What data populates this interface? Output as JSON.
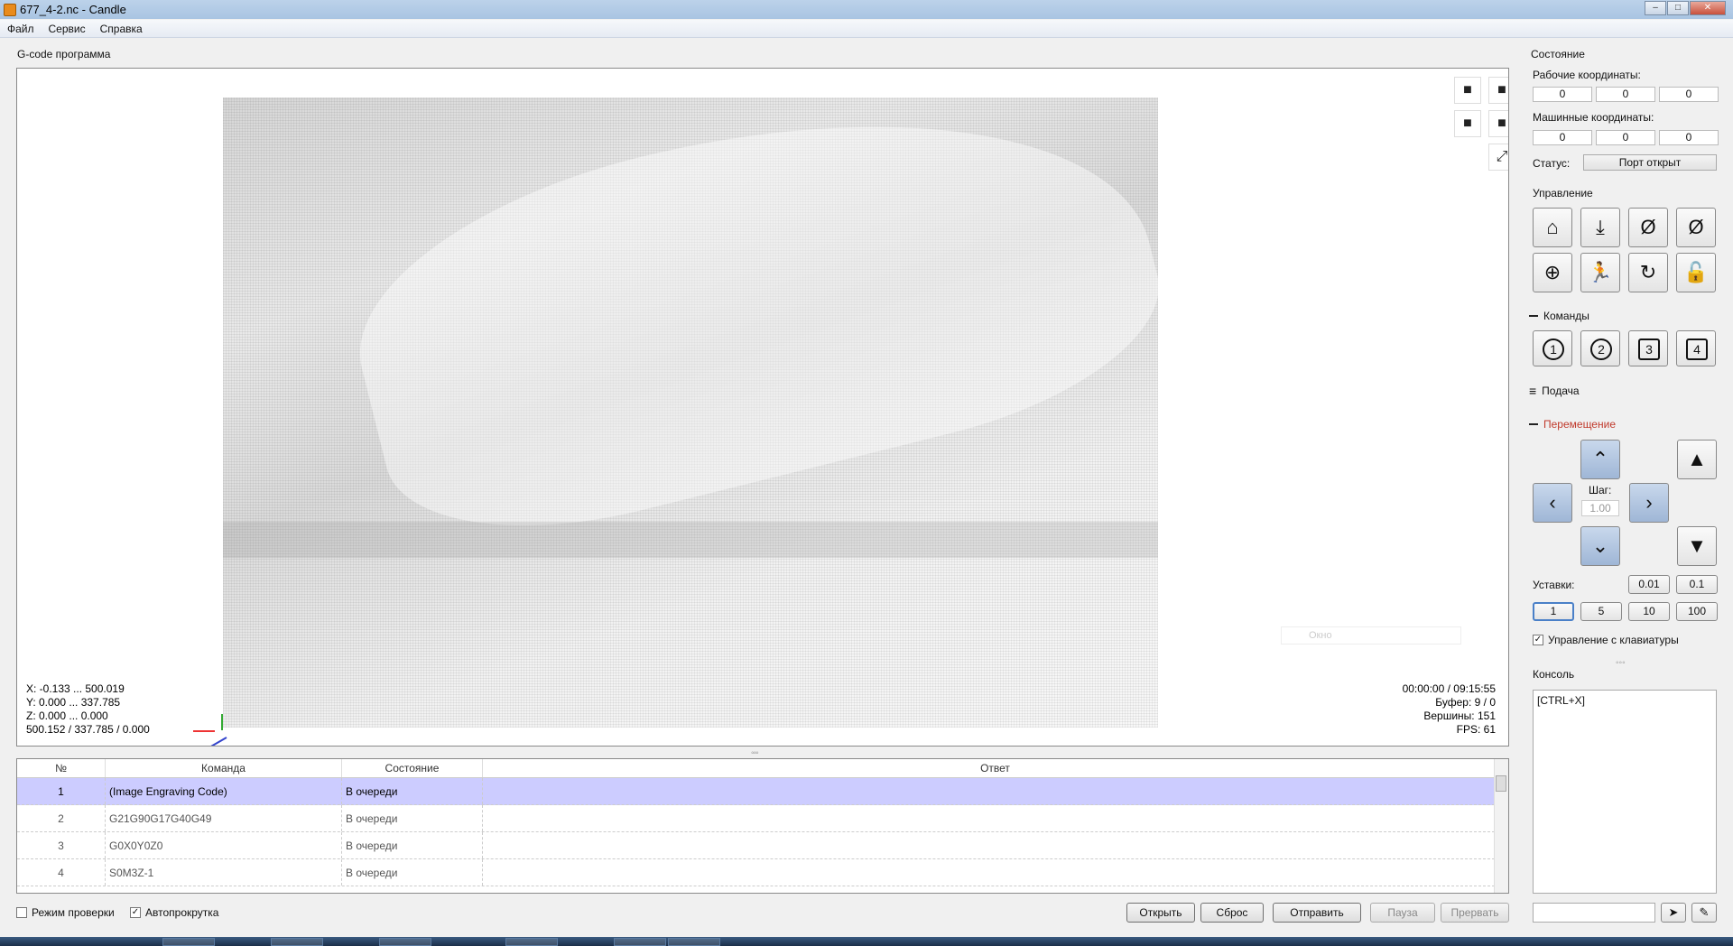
{
  "window": {
    "title": "677_4-2.nc - Candle",
    "min": "–",
    "max": "□",
    "close": "✕"
  },
  "menu": [
    "Файл",
    "Сервис",
    "Справка"
  ],
  "gcode_title": "G-code программа",
  "viewport": {
    "stats_left": [
      "X: -0.133 ... 500.019",
      "Y: 0.000 ... 337.785",
      "Z: 0.000 ... 0.000",
      "500.152 / 337.785 / 0.000"
    ],
    "stats_right": [
      "00:00:00 / 09:15:55",
      "Буфер: 9 / 0",
      "Вершины: 151",
      "FPS: 61"
    ],
    "ghost_window": "Окно",
    "view_icons": [
      "cube-front-icon",
      "cube-iso-icon",
      "cube-left-icon",
      "cube-top-icon"
    ],
    "fit": "⤢"
  },
  "splitter": "◦◦◦",
  "table": {
    "headers": [
      "№",
      "Команда",
      "Состояние",
      "Ответ"
    ],
    "rows": [
      {
        "n": "1",
        "cmd": "(Image Engraving Code)",
        "state": "В очереди",
        "resp": ""
      },
      {
        "n": "2",
        "cmd": "G21G90G17G40G49",
        "state": "В очереди",
        "resp": ""
      },
      {
        "n": "3",
        "cmd": "G0X0Y0Z0",
        "state": "В очереди",
        "resp": ""
      },
      {
        "n": "4",
        "cmd": "S0M3Z-1",
        "state": "В очереди",
        "resp": ""
      }
    ]
  },
  "bottom": {
    "check_mode": "Режим проверки",
    "autoscroll": "Автопрокрутка",
    "autoscroll_mark": "✓",
    "open": "Открыть",
    "reset": "Сброс",
    "send": "Отправить",
    "pause": "Пауза",
    "abort": "Прервать"
  },
  "state": {
    "title": "Состояние",
    "work_label": "Рабочие координаты:",
    "work": [
      "0",
      "0",
      "0"
    ],
    "machine_label": "Машинные координаты:",
    "machine": [
      "0",
      "0",
      "0"
    ],
    "status_label": "Статус:",
    "status": "Порт открыт"
  },
  "control": {
    "title": "Управление",
    "buttons": [
      {
        "name": "home-icon",
        "glyph": "⌂"
      },
      {
        "name": "probe-z-icon",
        "glyph": "⤓"
      },
      {
        "name": "zero-xy-icon",
        "glyph": "Ø"
      },
      {
        "name": "zero-z-icon",
        "glyph": "Ø"
      },
      {
        "name": "origin-icon",
        "glyph": "⊕"
      },
      {
        "name": "safe-position-icon",
        "glyph": "🏃"
      },
      {
        "name": "restore-icon",
        "glyph": "↻"
      },
      {
        "name": "unlock-icon",
        "glyph": "🔓"
      }
    ]
  },
  "commands": {
    "title": "Команды",
    "buttons": [
      "1",
      "2",
      "3",
      "4"
    ]
  },
  "feed": {
    "title": "Подача"
  },
  "jog": {
    "title": "Перемещение",
    "title_color": "#c0392b",
    "step_label": "Шаг:",
    "step_value": "1.00",
    "up": "⌃",
    "down": "⌄",
    "left": "‹",
    "right": "›",
    "z_up": "▲",
    "z_down": "▼",
    "presets_label": "Уставки:",
    "presets_row1": [
      "0.01",
      "0.1"
    ],
    "presets_row2": [
      "1",
      "5",
      "10",
      "100"
    ],
    "keyboard": "Управление с клавиатуры",
    "keyboard_mark": "✓"
  },
  "console": {
    "title": "Консоль",
    "text": "[CTRL+X]",
    "send_icon": "➤",
    "clear_icon": "✎"
  }
}
